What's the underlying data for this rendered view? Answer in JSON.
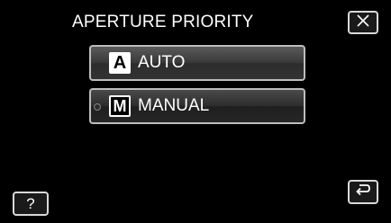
{
  "header": {
    "title": "APERTURE PRIORITY",
    "close_icon": "close-icon"
  },
  "menu": {
    "items": [
      {
        "icon_letter": "A",
        "label": "AUTO",
        "icon": "auto-mode-icon"
      },
      {
        "icon_letter": "M",
        "label": "MANUAL",
        "icon": "manual-mode-icon"
      }
    ]
  },
  "footer": {
    "help_label": "?",
    "back_icon": "return-icon"
  },
  "colors": {
    "background": "#000000",
    "button_border": "#d9d9d9",
    "text": "#ffffff"
  }
}
